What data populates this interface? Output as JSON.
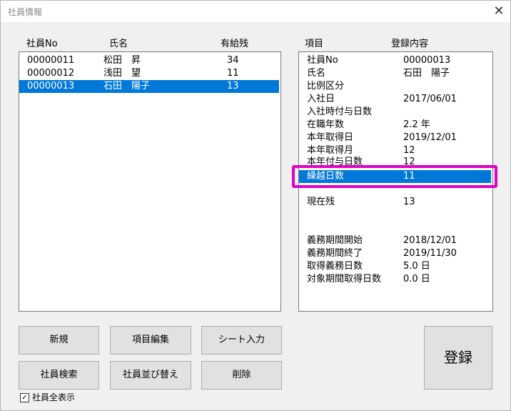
{
  "window": {
    "title": "社員情報"
  },
  "icons": {
    "close": "close-icon",
    "checkbox": "check-icon"
  },
  "colors": {
    "selection": "#0078d7",
    "highlight": "#e000c8"
  },
  "employee_list": {
    "headers": [
      "社員No",
      "氏名",
      "有給残"
    ],
    "rows": [
      {
        "no": "00000011",
        "name": "松田　昇",
        "remain": "34"
      },
      {
        "no": "00000012",
        "name": "浅田　望",
        "remain": "11"
      },
      {
        "no": "00000013",
        "name": "石田　陽子",
        "remain": "13"
      }
    ],
    "selected_index": 2
  },
  "detail": {
    "headers": [
      "項目",
      "登録内容"
    ],
    "rows": [
      {
        "label": "社員No",
        "value": "00000013"
      },
      {
        "label": "氏名",
        "value": "石田　陽子"
      },
      {
        "label": "比例区分",
        "value": ""
      },
      {
        "label": "入社日",
        "value": "2017/06/01"
      },
      {
        "label": "入社時付与日数",
        "value": ""
      },
      {
        "label": "在職年数",
        "value": "2.2 年"
      },
      {
        "label": "本年取得日",
        "value": "2019/12/01"
      },
      {
        "label": "本年取得月",
        "value": "12"
      },
      {
        "label": "本年付与日数",
        "value": "12"
      },
      {
        "label": "繰越日数",
        "value": "11"
      },
      {
        "label": "",
        "value": ""
      },
      {
        "label": "現在残",
        "value": "13"
      },
      {
        "label": "",
        "value": ""
      },
      {
        "label": "",
        "value": ""
      },
      {
        "label": "義務期間開始",
        "value": "2018/12/01"
      },
      {
        "label": "義務期間終了",
        "value": "2019/11/30"
      },
      {
        "label": "取得義務日数",
        "value": "5.0 日"
      },
      {
        "label": "対象期間取得日数",
        "value": "0.0 日"
      }
    ],
    "selected_index": 9
  },
  "buttons": {
    "new": "新規",
    "edit_items": "項目編集",
    "sheet_input": "シート入力",
    "search": "社員検索",
    "sort": "社員並び替え",
    "delete": "削除",
    "register": "登録"
  },
  "checkbox": {
    "label": "社員全表示",
    "checked": true,
    "mark": "✓"
  }
}
